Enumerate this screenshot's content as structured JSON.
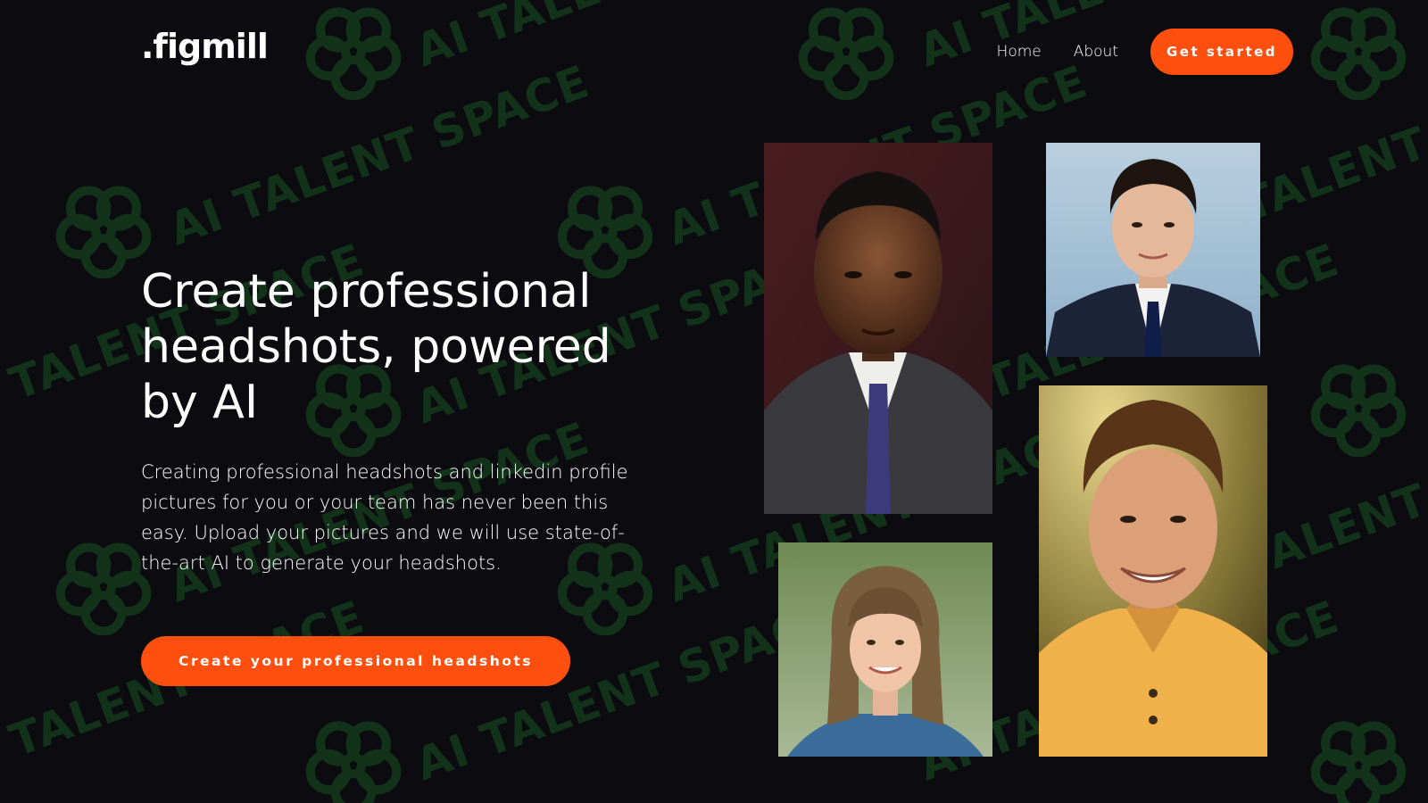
{
  "header": {
    "logo_text": ".figmill",
    "nav": [
      {
        "label": "Home"
      },
      {
        "label": "About"
      }
    ],
    "cta_label": "Get started"
  },
  "hero": {
    "title": "Create professional headshots, powered by AI",
    "description": "Creating professional headshots and linkedin profile pictures for you or your team has never been this easy. Upload your pictures and we will use state-of-the-art AI to generate your headshots.",
    "cta_label": "Create your professional headshots"
  },
  "watermark": {
    "text": "AI TALENT SPACE"
  },
  "photos": [
    {
      "name": "headshot-man-dark-suit"
    },
    {
      "name": "headshot-young-man-blue-suit"
    },
    {
      "name": "headshot-woman-bangs"
    },
    {
      "name": "headshot-smiling-man-yellow-polo"
    }
  ],
  "colors": {
    "background": "#0c0c10",
    "accent": "#ff4f0f",
    "text": "#ffffff",
    "watermark": "#12331a"
  }
}
